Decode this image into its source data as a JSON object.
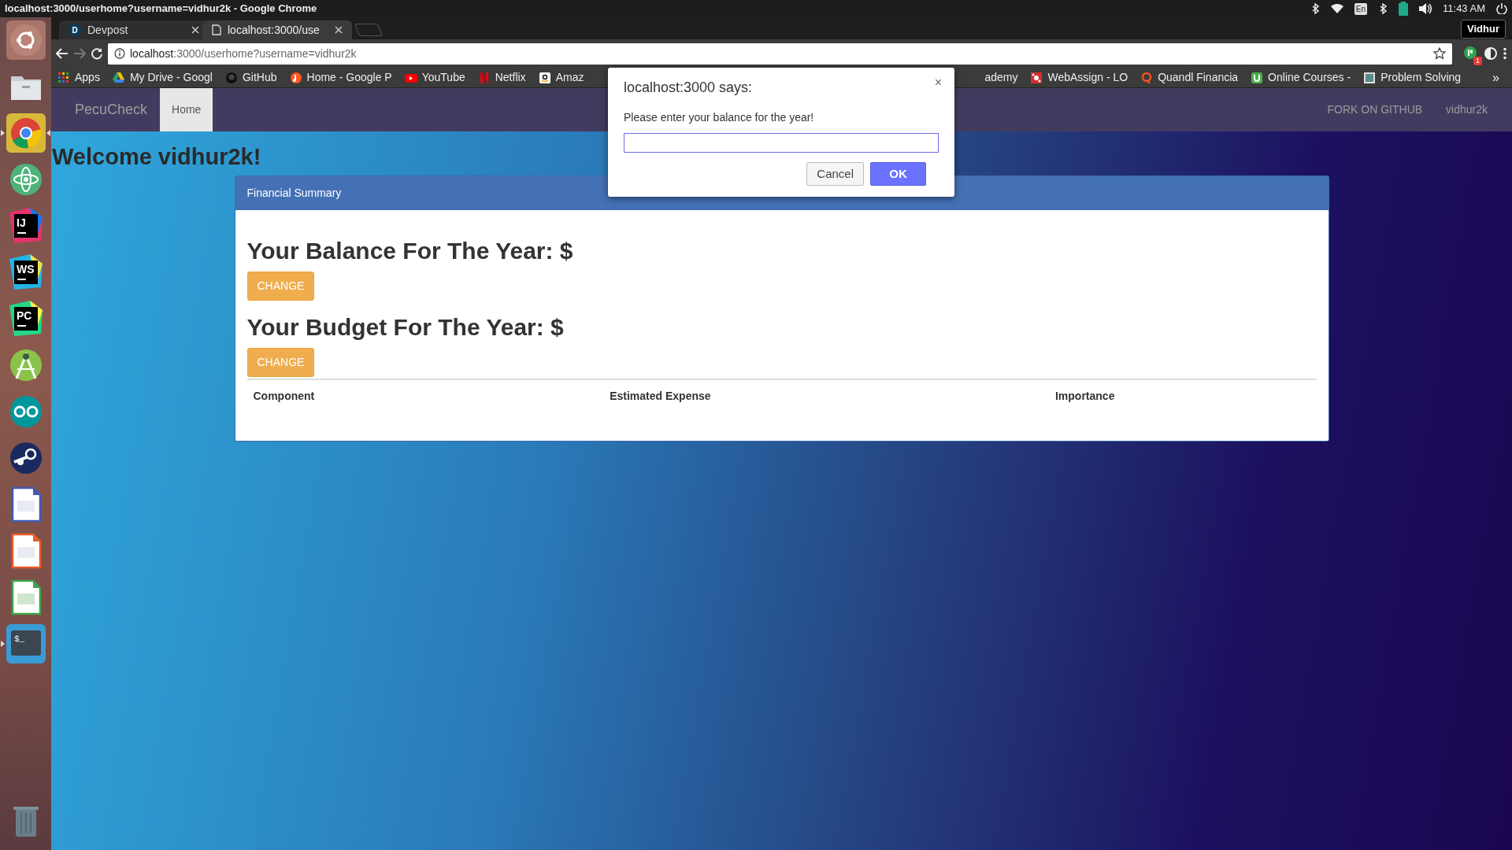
{
  "system_bar": {
    "title": "localhost:3000/userhome?username=vidhur2k - Google Chrome",
    "keyboard": "En",
    "time": "11:43 AM"
  },
  "launcher": [
    {
      "kind": "ubuntu",
      "focused": false,
      "running": false
    },
    {
      "kind": "files",
      "focused": false,
      "running": false
    },
    {
      "kind": "chrome",
      "focused": true,
      "running": true
    },
    {
      "kind": "atom",
      "focused": false,
      "running": false
    },
    {
      "kind": "jetbrains",
      "badge": "IJ",
      "focused": false,
      "running": false
    },
    {
      "kind": "jetbrains",
      "badge": "WS",
      "focused": false,
      "running": false
    },
    {
      "kind": "jetbrains",
      "badge": "PC",
      "focused": false,
      "running": false
    },
    {
      "kind": "android",
      "focused": false,
      "running": false
    },
    {
      "kind": "arduino",
      "focused": false,
      "running": false
    },
    {
      "kind": "steam",
      "focused": false,
      "running": false
    },
    {
      "kind": "writer",
      "focused": false,
      "running": false
    },
    {
      "kind": "impress",
      "focused": false,
      "running": false
    },
    {
      "kind": "calc",
      "focused": false,
      "running": false
    },
    {
      "kind": "terminal",
      "badge": "$_",
      "focused": false,
      "running": true
    },
    {
      "kind": "trash",
      "focused": false,
      "running": false
    }
  ],
  "profile": "Vidhur",
  "tabs": [
    {
      "title": "Devpost",
      "icon_letter": "D",
      "selected": false
    },
    {
      "title": "localhost:3000/use",
      "selected": true
    }
  ],
  "address_bar": {
    "host": "localhost",
    "path": ":3000/userhome?username=vidhur2k"
  },
  "extension_badge": "1",
  "bookmarks": [
    {
      "label": "Apps"
    },
    {
      "label": "My Drive - Googl"
    },
    {
      "label": "GitHub"
    },
    {
      "label": "Home - Google P"
    },
    {
      "label": "YouTube"
    },
    {
      "label": "Netflix"
    },
    {
      "label": "Amaz"
    },
    {
      "label": "ademy"
    },
    {
      "label": "WebAssign - LO"
    },
    {
      "label": "Quandl Financia"
    },
    {
      "label": "Online Courses -"
    },
    {
      "label": "Problem Solving"
    }
  ],
  "bookmarks_overflow": "»",
  "navbar": {
    "brand": "PecuCheck",
    "items": [
      {
        "label": "Home",
        "selected": true
      }
    ],
    "right_items": [
      {
        "label": "FORK ON GITHUB"
      },
      {
        "label": "vidhur2k"
      }
    ]
  },
  "welcome": "Welcome vidhur2k!",
  "card": {
    "header": "Financial Summary",
    "sections": [
      {
        "heading": "Your Balance For The Year: $",
        "button": "CHANGE"
      },
      {
        "heading": "Your Budget For The Year: $",
        "button": "CHANGE"
      }
    ],
    "table": {
      "columns": [
        "Component",
        "Estimated Expense",
        "Importance"
      ]
    }
  },
  "dialog": {
    "title": "localhost:3000 says:",
    "close": "×",
    "message": "Please enter your balance for the year!",
    "buttons": [
      {
        "label": "Cancel",
        "kind": "secondary"
      },
      {
        "label": "OK",
        "kind": "primary"
      }
    ]
  }
}
